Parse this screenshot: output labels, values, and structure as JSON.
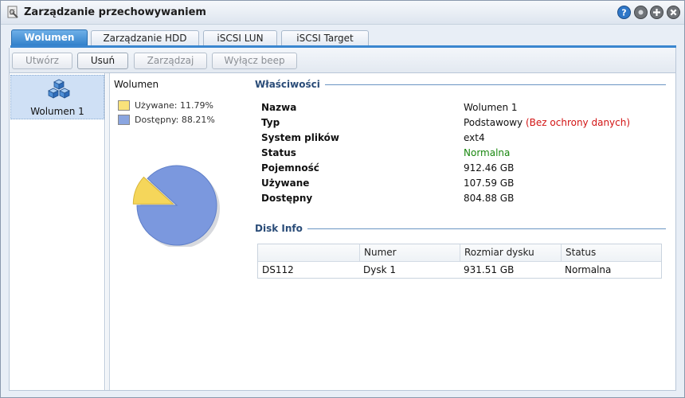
{
  "window": {
    "title": "Zarządzanie przechowywaniem"
  },
  "tabs": [
    {
      "label": "Wolumen",
      "active": true
    },
    {
      "label": "Zarządzanie HDD",
      "active": false
    },
    {
      "label": "iSCSI LUN",
      "active": false
    },
    {
      "label": "iSCSI Target",
      "active": false
    }
  ],
  "toolbar": {
    "create_label": "Utwórz",
    "delete_label": "Usuń",
    "manage_label": "Zarządzaj",
    "beep_label": "Wyłącz beep"
  },
  "volumes": [
    {
      "label": "Wolumen 1",
      "selected": true
    }
  ],
  "chart": {
    "title": "Wolumen",
    "legend": [
      {
        "label": "Używane: 11.79%",
        "color": "#f9e27a"
      },
      {
        "label": "Dostępny: 88.21%",
        "color": "#8aa5e0"
      }
    ]
  },
  "chart_data": {
    "type": "pie",
    "title": "Wolumen",
    "slices": [
      {
        "name": "Używane",
        "value": 11.79,
        "color": "#f5d65a"
      },
      {
        "name": "Dostępny",
        "value": 88.21,
        "color": "#7b98de"
      }
    ]
  },
  "properties": {
    "section_title": "Właściwości",
    "rows": [
      {
        "label": "Nazwa",
        "value": "Wolumen 1"
      },
      {
        "label": "Typ",
        "value": "Podstawowy",
        "extra": "(Bez ochrony danych)"
      },
      {
        "label": "System plików",
        "value": "ext4"
      },
      {
        "label": "Status",
        "value": "Normalna"
      },
      {
        "label": "Pojemność",
        "value": "912.46 GB"
      },
      {
        "label": "Używane",
        "value": "107.59 GB"
      },
      {
        "label": "Dostępny",
        "value": "804.88 GB"
      }
    ]
  },
  "disk_info": {
    "section_title": "Disk Info",
    "columns": [
      "",
      "Numer",
      "Rozmiar dysku",
      "Status"
    ],
    "rows": [
      {
        "device": "DS112",
        "number": "Dysk 1",
        "size": "931.51 GB",
        "status": "Normalna"
      }
    ]
  },
  "colors": {
    "accent": "#3a86cf",
    "status_ok": "#19870f",
    "warning": "#d21414"
  },
  "icons": {
    "help": "help-icon",
    "minimize": "minimize-icon",
    "maximize": "maximize-icon",
    "close": "close-icon",
    "app": "storage-app-icon",
    "volume": "volume-cubes-icon"
  }
}
